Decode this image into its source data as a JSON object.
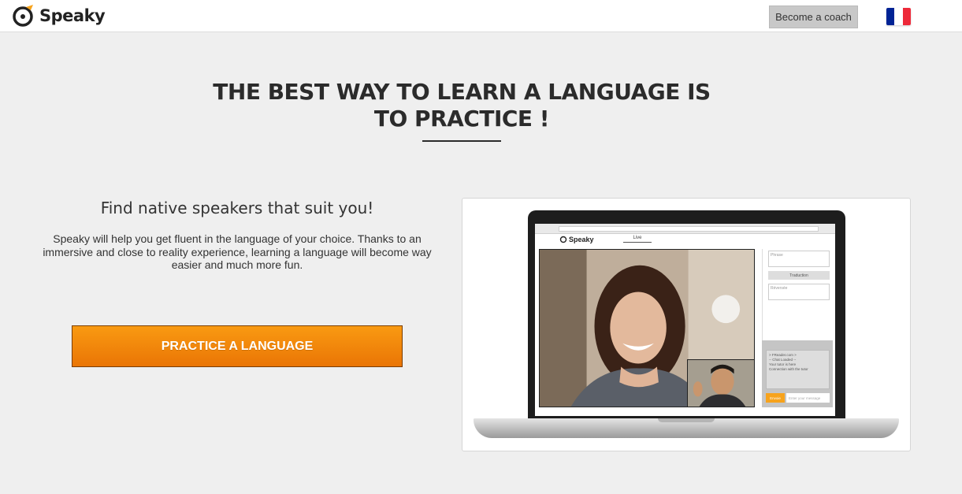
{
  "header": {
    "logo_text": "Speaky",
    "coach_button": "Become a coach",
    "flag_colors": [
      "#002395",
      "#ffffff",
      "#ed2939"
    ]
  },
  "hero": {
    "title_line1": "THE BEST WAY TO LEARN A LANGUAGE IS",
    "title_line2": "TO PRACTICE !"
  },
  "intro": {
    "subhead": "Find native speakers that suit you!",
    "description": "Speaky will help you get fluent in the language of your choice. Thanks to an immersive and close to reality experience, learning a language will become way easier and much more fun.",
    "cta_label": "PRACTICE A LANGUAGE"
  },
  "preview": {
    "app_logo": "Speaky",
    "live_tab": "Live",
    "phrase_placeholder": "Phrase",
    "translation_label": "Traduction",
    "reverse_placeholder": "Réversée",
    "chat_log": [
      "> FReader.com >",
      "-- Chat Loaded --",
      "Your tutor is here",
      "Connection with the tutor"
    ],
    "send_label": "Envoie",
    "chat_placeholder": "Enter your message"
  },
  "colors": {
    "accent": "#f28a0a",
    "accent_border": "#7a3d00",
    "background": "#efefef"
  }
}
